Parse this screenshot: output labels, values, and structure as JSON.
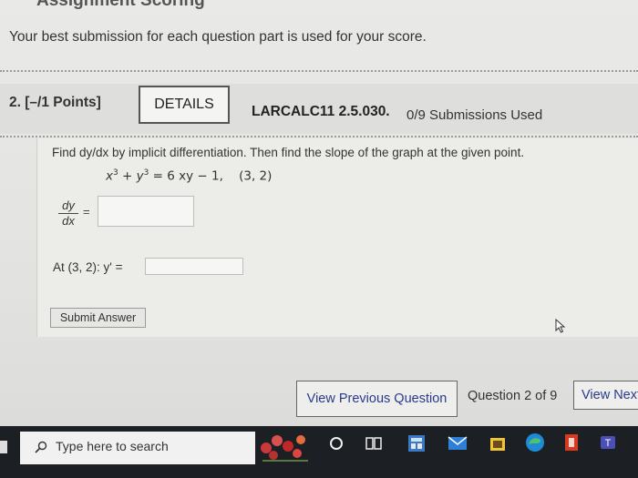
{
  "page": {
    "top_title": "Assignment Scoring",
    "best_note": "Your best submission for each question part is used for your score."
  },
  "question": {
    "number": "2.  [–/1 Points]",
    "details_label": "DETAILS",
    "code": "LARCALC11 2.5.030.",
    "submissions": "0/9 Submissions Used",
    "prompt": "Find dy/dx by implicit differentiation. Then find the slope of the graph at the given point.",
    "equation": {
      "lhs_a": "x",
      "lhs_b": "y",
      "exp": "3",
      "rest": "= 6 xy − 1,",
      "point": "(3, 2)"
    },
    "fraction": {
      "num": "dy",
      "den": "dx",
      "eq": "="
    },
    "input1_value": "",
    "at_label": "At (3, 2): y' =",
    "input2_value": "",
    "submit_label": "Submit Answer"
  },
  "nav": {
    "prev_label": "View Previous Question",
    "position": "Question 2 of 9",
    "next_label": "View Next"
  },
  "taskbar": {
    "search_placeholder": "Type here to search"
  },
  "colors": {
    "link": "#2a3a8a",
    "taskbar": "#1c1f24"
  }
}
